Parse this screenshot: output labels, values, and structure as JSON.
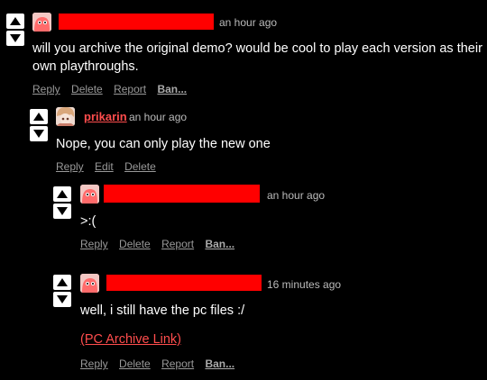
{
  "colors": {
    "background": "#000000",
    "text": "#ffffff",
    "muted": "#bbbbbb",
    "accent": "#ff4d4d",
    "redaction": "#ff0000"
  },
  "icons": {
    "upvote": "up-triangle",
    "downvote": "down-triangle",
    "avatar": "pink-creature-avatar"
  },
  "comments": [
    {
      "username_redacted": true,
      "time": "an hour ago",
      "body": "will you archive the original demo? would be cool to play each version as their own playthroughs.",
      "actions": [
        "Reply",
        "Delete",
        "Report",
        "Ban..."
      ]
    },
    {
      "username": "prikarin",
      "time": "an hour ago",
      "body": "Nope, you can only play the new one",
      "actions": [
        "Reply",
        "Edit",
        "Delete"
      ]
    },
    {
      "username_redacted": true,
      "time": "an hour ago",
      "body": ">:(",
      "actions": [
        "Reply",
        "Delete",
        "Report",
        "Ban..."
      ]
    },
    {
      "username_redacted": true,
      "time": "16 minutes ago",
      "body": "well, i still have the pc files :/",
      "link": "(PC Archive Link)",
      "actions": [
        "Reply",
        "Delete",
        "Report",
        "Ban..."
      ]
    }
  ]
}
